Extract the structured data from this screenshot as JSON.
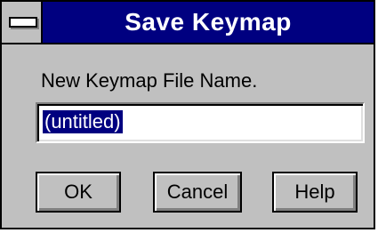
{
  "window": {
    "title": "Save Keymap"
  },
  "form": {
    "prompt": "New Keymap File Name.",
    "filename_value": "(untitled)"
  },
  "buttons": {
    "ok": "OK",
    "cancel": "Cancel",
    "help": "Help"
  },
  "colors": {
    "title_bar": "#000080",
    "dialog_face": "#c0c0c0",
    "selection": "#000080"
  },
  "icons": {
    "system_menu": "system-menu-icon"
  }
}
